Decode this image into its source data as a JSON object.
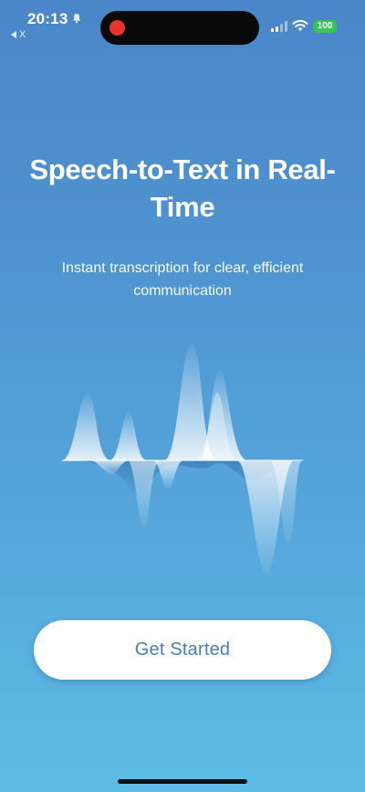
{
  "status_bar": {
    "time": "20:13",
    "back_label": "X",
    "battery": "100",
    "colors": {
      "record": "#e8342c",
      "battery": "#37c35a"
    },
    "icons": [
      "bell-icon",
      "back-arrow-icon",
      "signal-icon",
      "wifi-icon",
      "battery-icon"
    ]
  },
  "hero": {
    "title": "Speech-to-Text in Real-Time",
    "subtitle": "Instant transcription for clear, efficient communication"
  },
  "illustration": {
    "icon": "audio-waveform-icon"
  },
  "cta": {
    "label": "Get Started",
    "color": "#4a7fb5"
  },
  "theme": {
    "background_top": "#4a86c8",
    "background_bottom": "#5dbde5"
  }
}
